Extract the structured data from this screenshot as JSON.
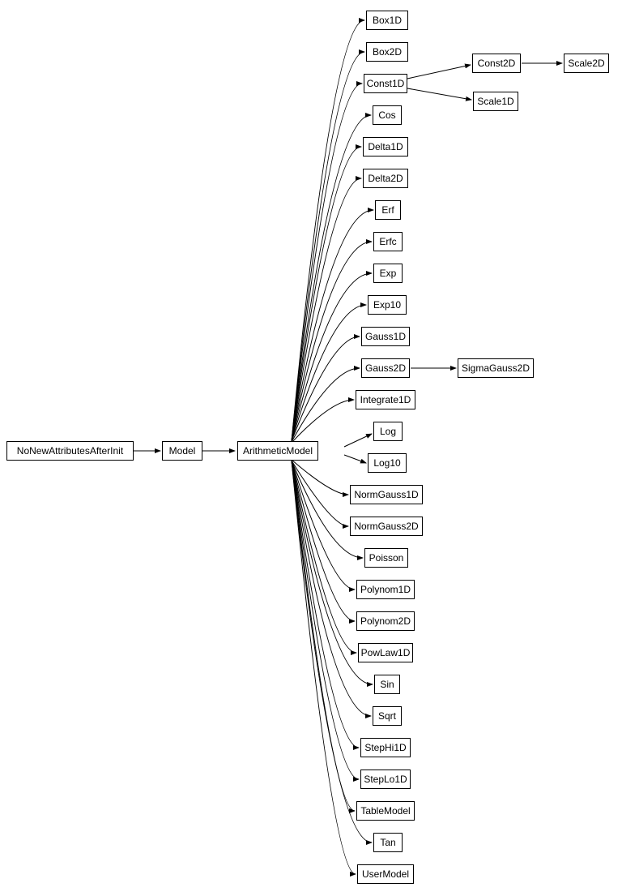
{
  "nodes": {
    "root": "NoNewAttributesAfterInit",
    "model": "Model",
    "arith": "ArithmeticModel",
    "box1d": "Box1D",
    "box2d": "Box2D",
    "const1d": "Const1D",
    "const2d": "Const2D",
    "scale2d": "Scale2D",
    "scale1d": "Scale1D",
    "cos": "Cos",
    "delta1d": "Delta1D",
    "delta2d": "Delta2D",
    "erf": "Erf",
    "erfc": "Erfc",
    "exp": "Exp",
    "exp10": "Exp10",
    "gauss1d": "Gauss1D",
    "gauss2d": "Gauss2D",
    "sigmagauss2d": "SigmaGauss2D",
    "integrate1d": "Integrate1D",
    "log": "Log",
    "log10": "Log10",
    "normgauss1d": "NormGauss1D",
    "normgauss2d": "NormGauss2D",
    "poisson": "Poisson",
    "polynom1d": "Polynom1D",
    "polynom2d": "Polynom2D",
    "powlaw1d": "PowLaw1D",
    "sin": "Sin",
    "sqrt": "Sqrt",
    "stephi1d": "StepHi1D",
    "steplo1d": "StepLo1D",
    "tablemodel": "TableModel",
    "tan": "Tan",
    "usermodel": "UserModel"
  }
}
